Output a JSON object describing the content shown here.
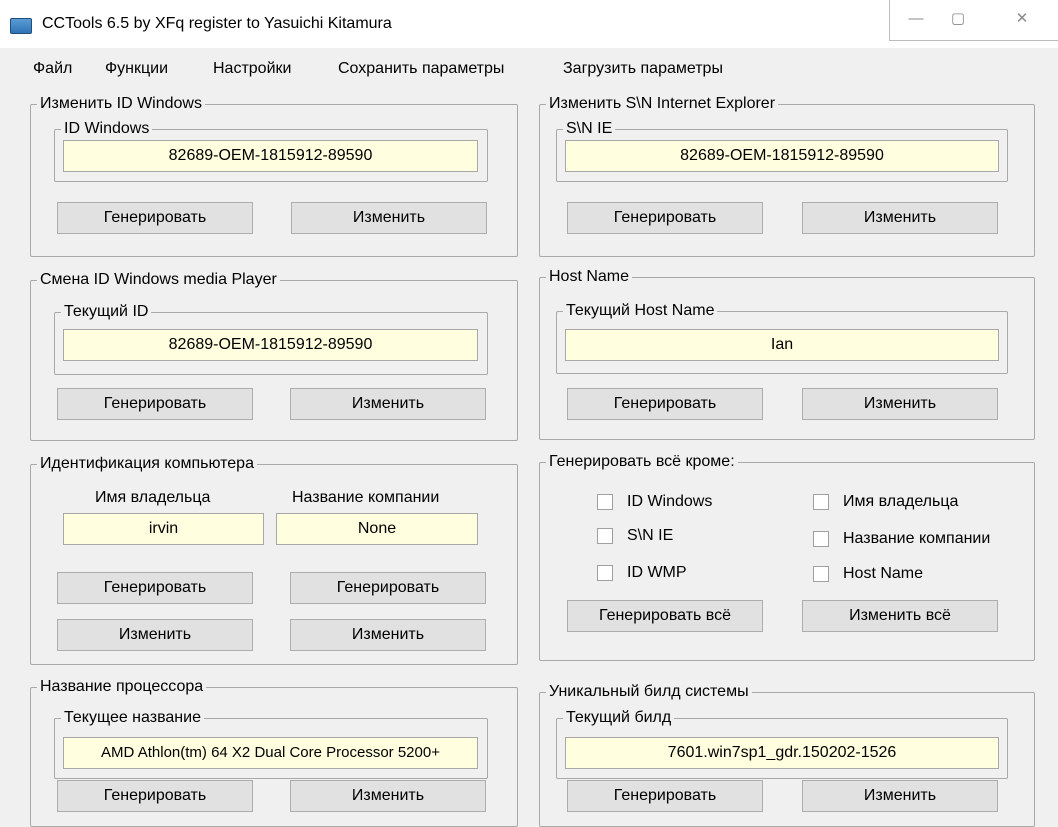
{
  "window": {
    "title": "CCTools 6.5 by XFq register to Yasuichi Kitamura",
    "minimize_glyph": "—",
    "maximize_glyph": "▢",
    "close_glyph": "✕"
  },
  "menu": [
    "Файл",
    "Функции",
    "Настройки",
    "Сохранить параметры",
    "Загрузить параметры"
  ],
  "windows_id": {
    "title": "Изменить ID Windows",
    "inner_title": "ID Windows",
    "value": "82689-OEM-1815912-89590",
    "generate_label": "Генерировать",
    "change_label": "Изменить"
  },
  "ie_sn": {
    "title": "Изменить S\\N Internet Explorer",
    "inner_title": "S\\N IE",
    "value": "82689-OEM-1815912-89590",
    "generate_label": "Генерировать",
    "change_label": "Изменить"
  },
  "wmp_id": {
    "title": "Смена ID Windows media Player",
    "inner_title": "Текущий ID",
    "value": "82689-OEM-1815912-89590",
    "generate_label": "Генерировать",
    "change_label": "Изменить"
  },
  "host_name": {
    "title": "Host Name",
    "inner_title": "Текущий Host Name",
    "value": "Ian",
    "generate_label": "Генерировать",
    "change_label": "Изменить"
  },
  "computer_id": {
    "title": "Идентификация компьютера",
    "owner_label": "Имя владельца",
    "company_label": "Название компании",
    "owner_value": "irvin",
    "company_value": "None",
    "generate_owner_label": "Генерировать",
    "generate_company_label": "Генерировать",
    "change_owner_label": "Изменить",
    "change_company_label": "Изменить"
  },
  "generate_all": {
    "title": "Генерировать всё кроме:",
    "checkboxes": [
      {
        "label": "ID Windows",
        "checked": false
      },
      {
        "label": "S\\N IE",
        "checked": false
      },
      {
        "label": "ID WMP",
        "checked": false
      },
      {
        "label": "Имя владельца",
        "checked": false
      },
      {
        "label": "Название компании",
        "checked": false
      },
      {
        "label": "Host Name",
        "checked": false
      }
    ],
    "generate_all_label": "Генерировать всё",
    "change_all_label": "Изменить всё"
  },
  "cpu_name": {
    "title": "Название процессора",
    "inner_title": "Текущее название",
    "value": "AMD Athlon(tm) 64 X2 Dual Core Processor 5200+",
    "generate_label": "Генерировать",
    "change_label": "Изменить"
  },
  "build": {
    "title": "Уникальный билд системы",
    "inner_title": "Текущий билд",
    "value": "7601.win7sp1_gdr.150202-1526",
    "generate_label": "Генерировать",
    "change_label": "Изменить"
  },
  "colors": {
    "window_bg": "#f0f0f0",
    "textbox_bg": "#ffffe0",
    "button_bg": "#e1e1e1",
    "border": "#a9a9a9"
  }
}
